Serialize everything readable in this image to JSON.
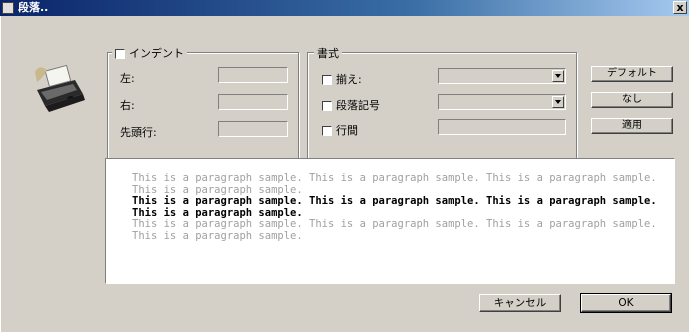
{
  "window": {
    "title": "段落..",
    "close_label": "x"
  },
  "indent": {
    "legend": "インデント",
    "left_label": "左:",
    "right_label": "右:",
    "first_line_label": "先頭行:"
  },
  "format": {
    "legend": "書式",
    "align_label": "揃え:",
    "para_mark_label": "段落記号",
    "line_spacing_label": "行間"
  },
  "side_buttons": {
    "default_label": "デフォルト",
    "none_label": "なし",
    "apply_label": "適用"
  },
  "preview": {
    "before_text": "This is a paragraph sample. This is a paragraph sample. This is a paragraph sample. This is a paragraph sample.",
    "current_text": "This is a paragraph sample. This is a paragraph sample. This is a paragraph sample. This is a paragraph sample.",
    "after_text": "This is a paragraph sample. This is a paragraph sample. This is a paragraph sample. This is a paragraph sample."
  },
  "footer": {
    "cancel_label": "キャンセル",
    "ok_label": "OK"
  }
}
